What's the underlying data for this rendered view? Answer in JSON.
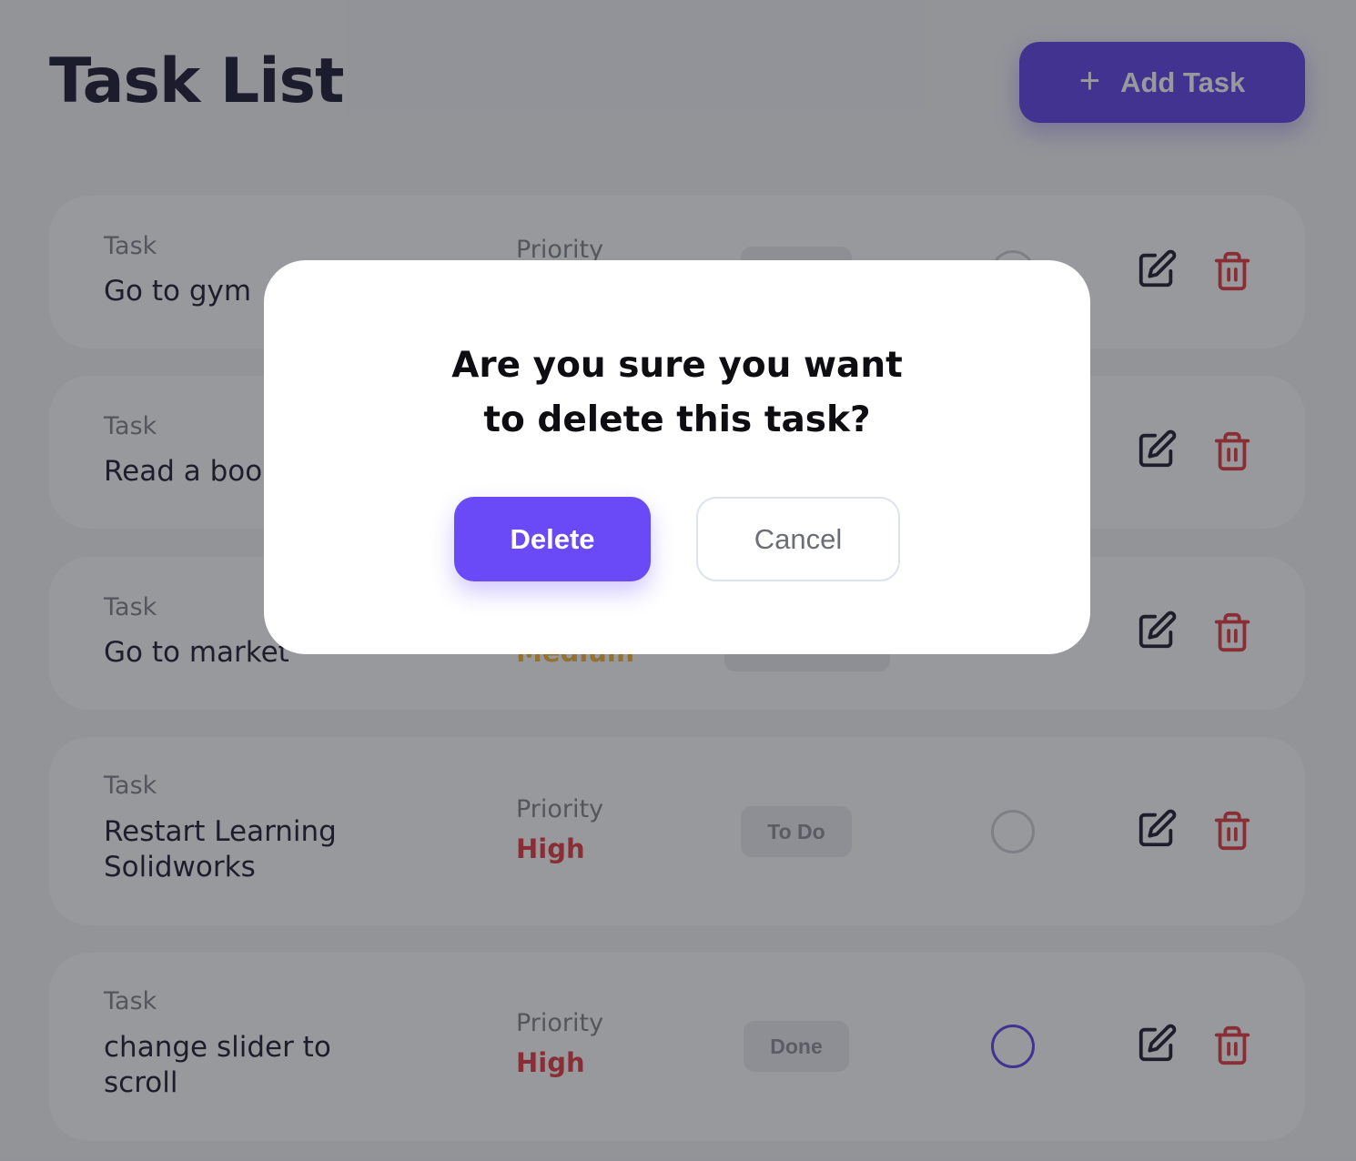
{
  "header": {
    "title": "Task List",
    "add_button_label": "Add Task",
    "add_icon": "plus-icon"
  },
  "labels": {
    "task": "Task",
    "priority": "Priority"
  },
  "colors": {
    "accent": "#5b3ce8",
    "high": "#e4323a",
    "medium": "#f3b234",
    "delete": "#e4323a"
  },
  "tasks": [
    {
      "name": "Go to gym",
      "priority": "",
      "status": "",
      "progress": ""
    },
    {
      "name": "Read a boo",
      "priority": "",
      "status": "",
      "progress": ""
    },
    {
      "name": "Go to market",
      "priority": "Medium",
      "status": "",
      "progress": ""
    },
    {
      "name": "Restart Learning Solidworks",
      "priority": "High",
      "status": "To Do",
      "progress": "not-started"
    },
    {
      "name": "change slider to scroll",
      "priority": "High",
      "status": "Done",
      "progress": "in-progress"
    }
  ],
  "icons": {
    "edit": "edit-icon",
    "delete": "trash-icon"
  },
  "modal": {
    "message": "Are you sure you want to delete this task?",
    "confirm_label": "Delete",
    "cancel_label": "Cancel"
  }
}
